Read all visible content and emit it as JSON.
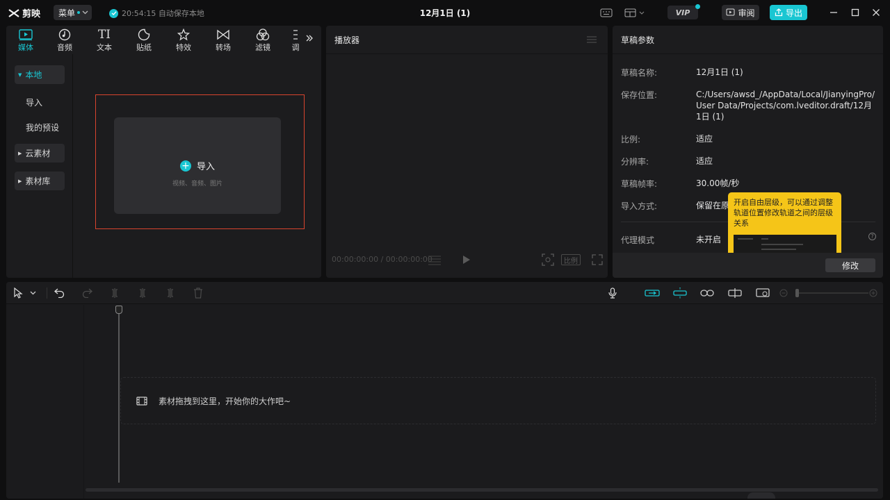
{
  "titlebar": {
    "app_name": "剪映",
    "menu_label": "菜单",
    "autosave_text": "20:54:15 自动保存本地",
    "document_title": "12月1日 (1)",
    "vip_label": "VIP",
    "review_label": "审阅",
    "export_label": "导出"
  },
  "media": {
    "tabs": [
      {
        "label": "媒体",
        "icon": "media-icon"
      },
      {
        "label": "音频",
        "icon": "audio-icon"
      },
      {
        "label": "文本",
        "icon": "text-icon"
      },
      {
        "label": "贴纸",
        "icon": "sticker-icon"
      },
      {
        "label": "特效",
        "icon": "effects-icon"
      },
      {
        "label": "转场",
        "icon": "transition-icon"
      },
      {
        "label": "滤镜",
        "icon": "filter-icon"
      },
      {
        "label": "调",
        "icon": "adjust-icon"
      }
    ],
    "sidebar": {
      "local": "本地",
      "import": "导入",
      "my_presets": "我的预设",
      "cloud": "云素材",
      "library": "素材库"
    },
    "import_card": {
      "title": "导入",
      "subtitle": "视频、音频、图片"
    }
  },
  "player": {
    "title": "播放器",
    "timecode": "00:00:00:00 / 00:00:00:00",
    "ratio_label": "比例"
  },
  "params": {
    "title": "草稿参数",
    "rows": [
      {
        "key": "草稿名称:",
        "value": "12月1日 (1)"
      },
      {
        "key": "保存位置:",
        "value": "C:/Users/awsd_/AppData/Local/JianyingPro/User Data/Projects/com.lveditor.draft/12月1日 (1)"
      },
      {
        "key": "比例:",
        "value": "适应"
      },
      {
        "key": "分辨率:",
        "value": "适应"
      },
      {
        "key": "草稿帧率:",
        "value": "30.00帧/秒"
      },
      {
        "key": "导入方式:",
        "value": "保留在原"
      },
      {
        "key": "代理模式",
        "value": "未开启"
      }
    ],
    "modify_label": "修改",
    "tooltip_text": "开启自由层级，可以通过调整轨道位置修改轨道之间的层级关系"
  },
  "timeline": {
    "drop_hint": "素材拖拽到这里，开始你的大作吧~"
  },
  "colors": {
    "accent": "#19c6d2",
    "tooltip": "#f5c518",
    "selection_border": "#d9442e"
  }
}
